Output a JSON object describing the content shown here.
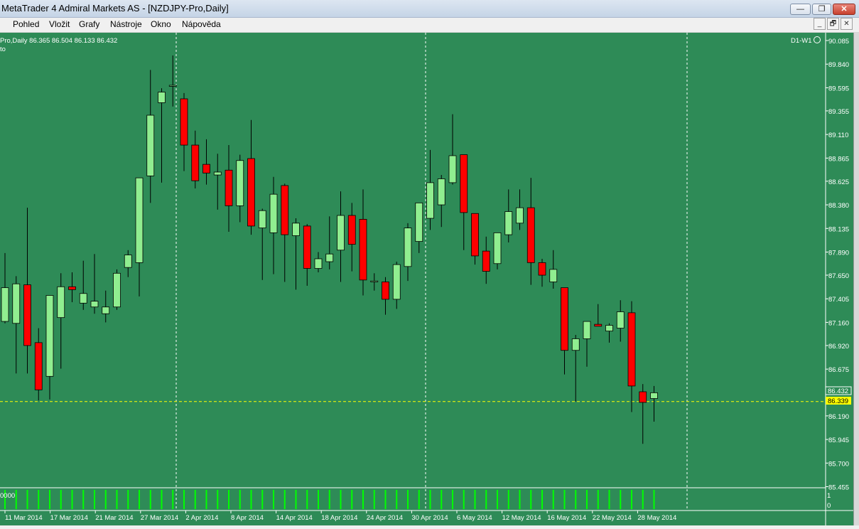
{
  "window": {
    "title": "MetaTrader 4 Admiral Markets AS - [NZDJPY-Pro,Daily]",
    "minimize_glyph": "—",
    "restore_glyph": "❐",
    "close_glyph": "✕"
  },
  "menu": [
    "Pohled",
    "Vložit",
    "Grafy",
    "Nástroje",
    "Okno",
    "Nápověda"
  ],
  "mdi": {
    "minimize_glyph": "_",
    "restore_glyph": "🗗",
    "close_glyph": "✕"
  },
  "chart": {
    "header": "Pro,Daily  86.365 86.504 86.133 86.432",
    "sub_header": "to",
    "timeframe_badge": "D1-W1",
    "current_price_label": "86.432",
    "bid_line_label": "86.339",
    "volume_label": "0000",
    "volume_axis": [
      "1",
      "0"
    ],
    "colors": {
      "background": "#2e8b57",
      "bull": "#90ee90",
      "bear": "#ff0000",
      "bid_line": "#ffff00",
      "volume": "#00ff00"
    }
  },
  "chart_data": {
    "type": "candlestick",
    "symbol": "NZDJPY-Pro",
    "timeframe": "Daily",
    "y_ticks": [
      "90.085",
      "89.840",
      "89.595",
      "89.355",
      "89.110",
      "88.865",
      "88.625",
      "88.380",
      "88.135",
      "87.890",
      "87.650",
      "87.405",
      "87.160",
      "86.920",
      "86.675",
      "86.190",
      "85.945",
      "85.700",
      "85.455"
    ],
    "x_ticks": [
      "11 Mar 2014",
      "17 Mar 2014",
      "21 Mar 2014",
      "27 Mar 2014",
      "2 Apr 2014",
      "8 Apr 2014",
      "14 Apr 2014",
      "18 Apr 2014",
      "24 Apr 2014",
      "30 Apr 2014",
      "6 May 2014",
      "12 May 2014",
      "16 May 2014",
      "22 May 2014",
      "28 May 2014"
    ],
    "ylim": [
      85.455,
      90.085
    ],
    "bid": 86.339,
    "last": 86.432,
    "candles": [
      {
        "o": 87.17,
        "h": 87.88,
        "l": 87.15,
        "c": 87.52
      },
      {
        "o": 87.15,
        "h": 87.64,
        "l": 86.63,
        "c": 87.56
      },
      {
        "o": 87.55,
        "h": 88.35,
        "l": 86.63,
        "c": 86.92
      },
      {
        "o": 86.95,
        "h": 87.1,
        "l": 86.35,
        "c": 86.46
      },
      {
        "o": 86.6,
        "h": 87.38,
        "l": 86.36,
        "c": 87.44
      },
      {
        "o": 87.21,
        "h": 87.67,
        "l": 86.68,
        "c": 87.53
      },
      {
        "o": 87.53,
        "h": 87.68,
        "l": 87.37,
        "c": 87.5
      },
      {
        "o": 87.36,
        "h": 87.8,
        "l": 87.29,
        "c": 87.46
      },
      {
        "o": 87.32,
        "h": 87.87,
        "l": 87.25,
        "c": 87.38
      },
      {
        "o": 87.25,
        "h": 87.49,
        "l": 87.16,
        "c": 87.32
      },
      {
        "o": 87.32,
        "h": 87.71,
        "l": 87.29,
        "c": 87.67
      },
      {
        "o": 87.73,
        "h": 87.91,
        "l": 87.63,
        "c": 87.86
      },
      {
        "o": 87.78,
        "h": 88.66,
        "l": 87.43,
        "c": 88.66
      },
      {
        "o": 88.68,
        "h": 89.78,
        "l": 88.4,
        "c": 89.31
      },
      {
        "o": 89.44,
        "h": 89.59,
        "l": 88.61,
        "c": 89.55
      },
      {
        "o": 89.61,
        "h": 89.93,
        "l": 89.4,
        "c": 89.62
      },
      {
        "o": 89.48,
        "h": 89.54,
        "l": 88.73,
        "c": 89.0
      },
      {
        "o": 89.0,
        "h": 89.15,
        "l": 88.55,
        "c": 88.63
      },
      {
        "o": 88.8,
        "h": 89.06,
        "l": 88.59,
        "c": 88.71
      },
      {
        "o": 88.69,
        "h": 88.91,
        "l": 88.33,
        "c": 88.72
      },
      {
        "o": 88.74,
        "h": 89.0,
        "l": 88.1,
        "c": 88.37
      },
      {
        "o": 88.37,
        "h": 88.9,
        "l": 88.2,
        "c": 88.84
      },
      {
        "o": 88.86,
        "h": 89.26,
        "l": 88.07,
        "c": 88.16
      },
      {
        "o": 88.14,
        "h": 88.34,
        "l": 87.6,
        "c": 88.32
      },
      {
        "o": 88.09,
        "h": 88.67,
        "l": 87.66,
        "c": 88.49
      },
      {
        "o": 88.58,
        "h": 88.6,
        "l": 87.58,
        "c": 88.07
      },
      {
        "o": 88.06,
        "h": 88.24,
        "l": 87.5,
        "c": 88.19
      },
      {
        "o": 88.16,
        "h": 88.18,
        "l": 87.54,
        "c": 87.72
      },
      {
        "o": 87.72,
        "h": 87.89,
        "l": 87.68,
        "c": 87.82
      },
      {
        "o": 87.79,
        "h": 88.26,
        "l": 87.71,
        "c": 87.87
      },
      {
        "o": 87.91,
        "h": 88.52,
        "l": 87.58,
        "c": 88.27
      },
      {
        "o": 88.27,
        "h": 88.4,
        "l": 87.69,
        "c": 87.97
      },
      {
        "o": 88.23,
        "h": 88.54,
        "l": 87.44,
        "c": 87.6
      },
      {
        "o": 87.58,
        "h": 87.67,
        "l": 87.49,
        "c": 87.59
      },
      {
        "o": 87.58,
        "h": 87.63,
        "l": 87.24,
        "c": 87.4
      },
      {
        "o": 87.4,
        "h": 87.79,
        "l": 87.3,
        "c": 87.76
      },
      {
        "o": 87.74,
        "h": 88.19,
        "l": 87.59,
        "c": 88.14
      },
      {
        "o": 88.0,
        "h": 88.4,
        "l": 87.88,
        "c": 88.4
      },
      {
        "o": 88.24,
        "h": 88.95,
        "l": 88.12,
        "c": 88.61
      },
      {
        "o": 88.38,
        "h": 88.69,
        "l": 88.15,
        "c": 88.65
      },
      {
        "o": 88.61,
        "h": 89.32,
        "l": 88.59,
        "c": 88.89
      },
      {
        "o": 88.9,
        "h": 88.9,
        "l": 87.91,
        "c": 88.3
      },
      {
        "o": 88.29,
        "h": 88.29,
        "l": 87.76,
        "c": 87.85
      },
      {
        "o": 87.9,
        "h": 88.05,
        "l": 87.56,
        "c": 87.69
      },
      {
        "o": 87.77,
        "h": 88.09,
        "l": 87.71,
        "c": 88.09
      },
      {
        "o": 88.07,
        "h": 88.54,
        "l": 87.99,
        "c": 88.31
      },
      {
        "o": 88.19,
        "h": 88.54,
        "l": 88.12,
        "c": 88.35
      },
      {
        "o": 88.35,
        "h": 88.66,
        "l": 87.55,
        "c": 87.78
      },
      {
        "o": 87.78,
        "h": 87.82,
        "l": 87.53,
        "c": 87.65
      },
      {
        "o": 87.58,
        "h": 87.91,
        "l": 87.51,
        "c": 87.71
      },
      {
        "o": 87.52,
        "h": 87.52,
        "l": 86.62,
        "c": 86.87
      },
      {
        "o": 86.87,
        "h": 87.03,
        "l": 86.34,
        "c": 86.99
      },
      {
        "o": 86.99,
        "h": 87.15,
        "l": 86.7,
        "c": 87.17
      },
      {
        "o": 87.14,
        "h": 87.35,
        "l": 87.12,
        "c": 87.12
      },
      {
        "o": 87.07,
        "h": 87.15,
        "l": 86.95,
        "c": 87.13
      },
      {
        "o": 87.1,
        "h": 87.39,
        "l": 86.96,
        "c": 87.27
      },
      {
        "o": 87.26,
        "h": 87.38,
        "l": 86.23,
        "c": 86.5
      },
      {
        "o": 86.44,
        "h": 86.52,
        "l": 85.9,
        "c": 86.33
      },
      {
        "o": 86.37,
        "h": 86.5,
        "l": 86.13,
        "c": 86.43
      }
    ]
  }
}
